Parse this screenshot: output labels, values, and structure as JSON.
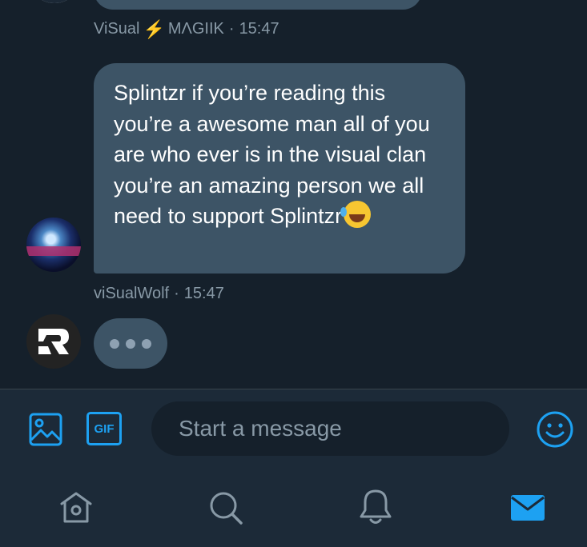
{
  "messages": [
    {
      "author": "ViSual",
      "author_suffix": "MΛGIIK",
      "separator": "·",
      "time": "15:47"
    },
    {
      "text": "Splintzr if you’re reading this you’re a awesome man all of you are who ever is in the visual clan you’re an amazing person we all need to support Splintzr",
      "emoji": "rolling-on-floor-laughing",
      "author": "viSualWolf",
      "separator": "·",
      "time": "15:47"
    }
  ],
  "composer": {
    "placeholder": "Start a message",
    "gif_label": "GIF"
  },
  "nav": {
    "items": [
      "home-icon",
      "search-icon",
      "notifications-icon",
      "messages-icon"
    ],
    "active": "messages-icon"
  },
  "colors": {
    "background": "#15202b",
    "bubble": "#3d5466",
    "accent": "#1da1f2",
    "meta_text": "#8899a6"
  }
}
